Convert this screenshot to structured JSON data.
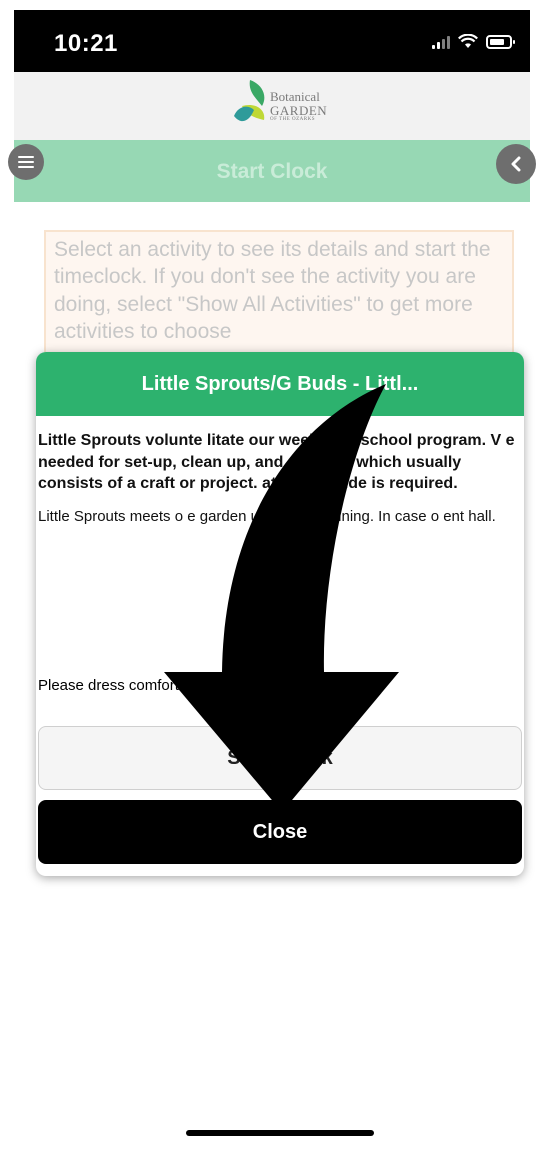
{
  "status_bar": {
    "time": "10:21",
    "icons": [
      "signal-icon",
      "wifi-icon",
      "battery-icon"
    ]
  },
  "logo": {
    "line1": "Botanical",
    "line2": "GARDEN",
    "line3": "OF THE OZARKS"
  },
  "nav": {
    "title": "Start Clock",
    "menu_icon": "menu-icon",
    "back_icon": "back-chevron-icon"
  },
  "info": {
    "text": "Select an activity to see its details and start the timeclock. If you don't see the activity you are doing, select \"Show All Activities\" to get more activities to choose"
  },
  "modal": {
    "title": "Little Sprouts/G        Buds - Littl...",
    "paragraph1": "Little Sprouts volunte             litate our weekly preschool program. V              e needed for set-up, clean up, and progra             e which usually consists of a craft or project.              atient attitude is required.",
    "paragraph2": "Little Sprouts meets o              e garden unless it is raining. In case o                  ent hall.",
    "paragraph3": "Please dress comfortably          the weather that day.",
    "start_label": "Start Clock",
    "close_label": "Close"
  },
  "colors": {
    "header_green": "#2db26e",
    "nav_green": "#97d8b4",
    "info_bg": "#fdf2e8"
  }
}
